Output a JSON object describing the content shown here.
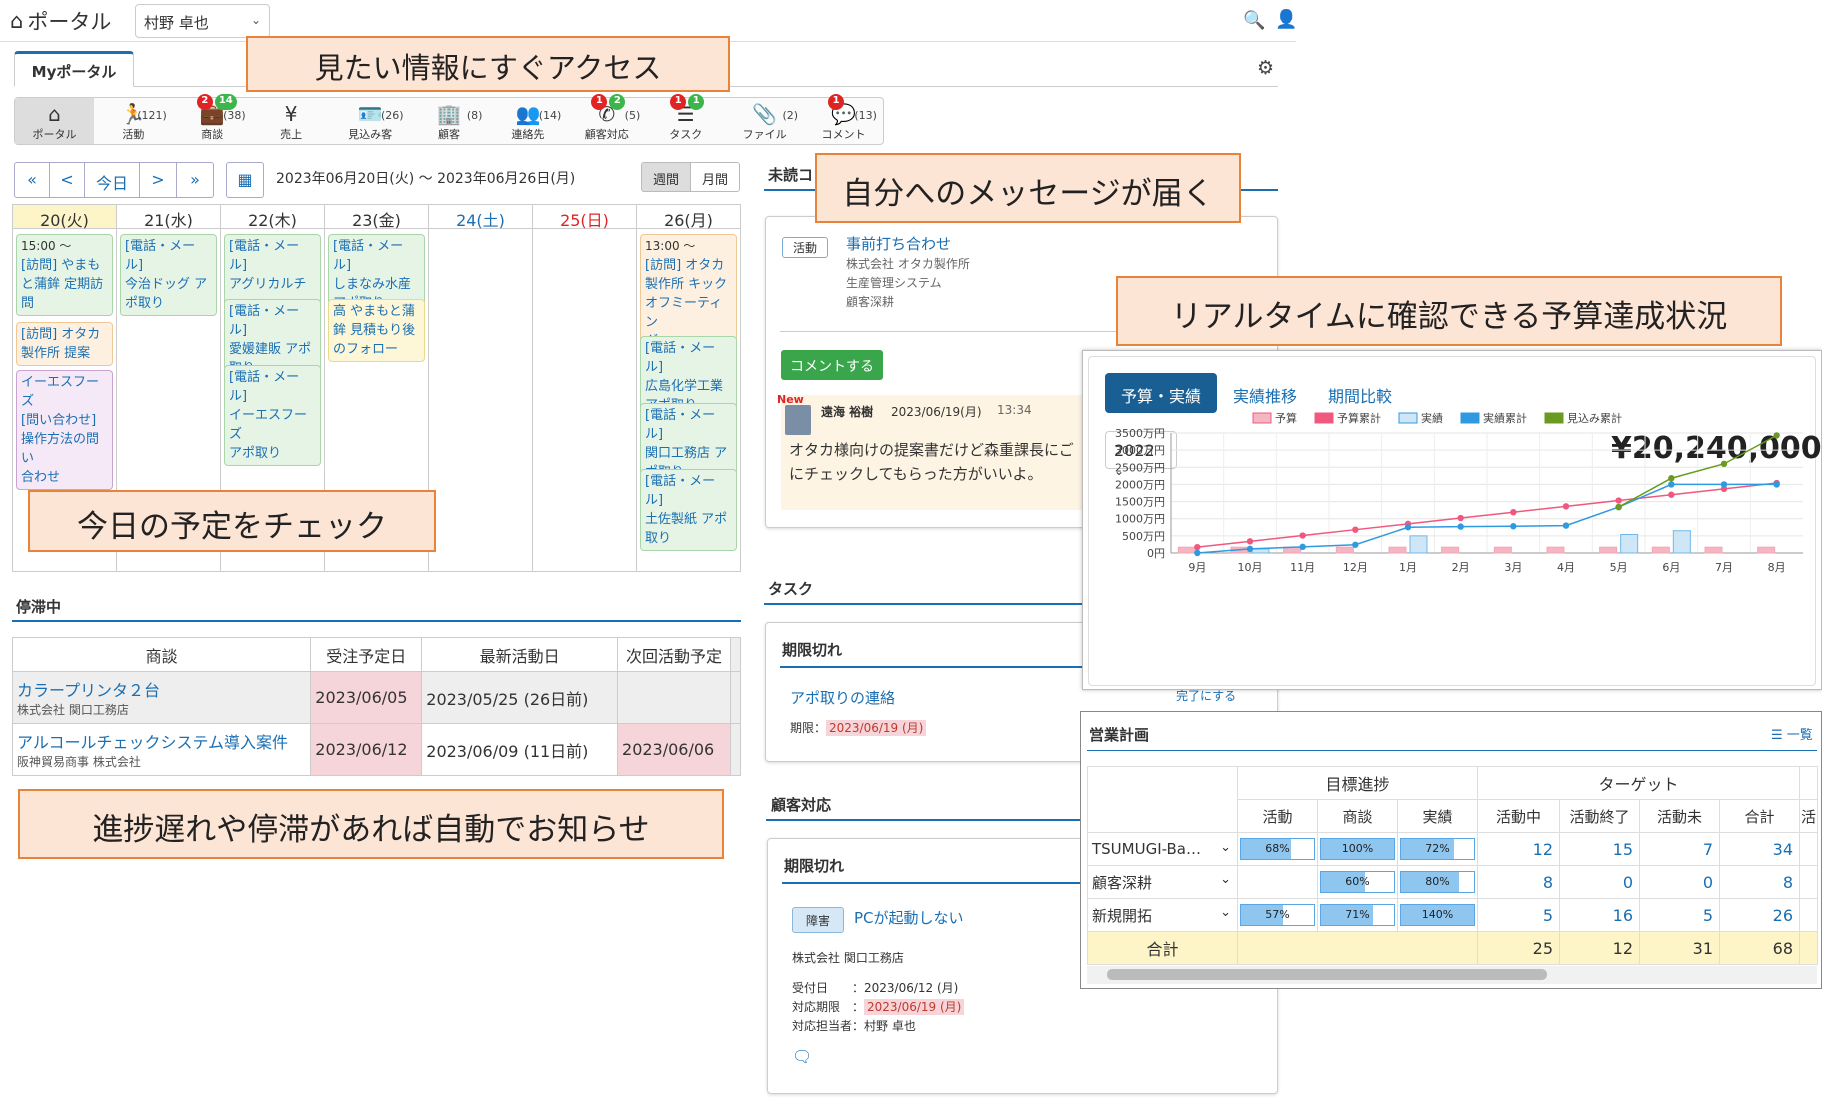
{
  "topbar": {
    "app_title": "ポータル",
    "user": "村野 卓也"
  },
  "tab": {
    "label": "Myポータル"
  },
  "modules": [
    {
      "icon": "home-icon",
      "label": "ポータル",
      "count": "",
      "badges": []
    },
    {
      "icon": "running-icon",
      "label": "活動",
      "count": "(121)",
      "badges": []
    },
    {
      "icon": "briefcase-icon",
      "label": "商談",
      "count": "(38)",
      "badges": [
        {
          "v": "2",
          "c": "red"
        },
        {
          "v": "14",
          "c": "green"
        }
      ]
    },
    {
      "icon": "yen-doc-icon",
      "label": "売上",
      "count": "",
      "badges": []
    },
    {
      "icon": "id-card-icon",
      "label": "見込み客",
      "count": "(26)",
      "badges": []
    },
    {
      "icon": "building-icon",
      "label": "顧客",
      "count": "(8)",
      "badges": []
    },
    {
      "icon": "people-icon",
      "label": "連絡先",
      "count": "(14)",
      "badges": []
    },
    {
      "icon": "phone-icon",
      "label": "顧客対応",
      "count": "(5)",
      "badges": [
        {
          "v": "1",
          "c": "red"
        },
        {
          "v": "2",
          "c": "green"
        }
      ]
    },
    {
      "icon": "tasks-icon",
      "label": "タスク",
      "count": "",
      "badges": [
        {
          "v": "1",
          "c": "red"
        },
        {
          "v": "1",
          "c": "green"
        }
      ]
    },
    {
      "icon": "paperclip-icon",
      "label": "ファイル",
      "count": "(2)",
      "badges": []
    },
    {
      "icon": "comments-icon",
      "label": "コメント",
      "count": "(13)",
      "badges": [
        {
          "v": "1",
          "c": "red"
        }
      ]
    }
  ],
  "calnav": {
    "first": "«",
    "prev": "<",
    "today": "今日",
    "next": ">",
    "last": "»",
    "range": "2023年06月20日(火) ～ 2023年06月26日(月)",
    "week": "週間",
    "month": "月間"
  },
  "calendar": {
    "days": [
      "20(火)",
      "21(水)",
      "22(木)",
      "23(金)",
      "24(土)",
      "25(日)",
      "26(月)"
    ],
    "events": [
      {
        "day": 0,
        "lines": [
          "15:00 ～",
          "[訪問] やまも",
          "と蒲鉾 定期訪",
          "問"
        ],
        "style": "green"
      },
      {
        "day": 0,
        "lines": [
          "[訪問] オタカ",
          "製作所 提案"
        ],
        "style": "orange"
      },
      {
        "day": 0,
        "lines": [
          "イーエスフーズ",
          "[問い合わせ]",
          "操作方法の問い",
          "合わせ"
        ],
        "style": "purple"
      },
      {
        "day": 1,
        "lines": [
          "[電話・メール]",
          "今治ドッグ ア",
          "ポ取り"
        ],
        "style": "green"
      },
      {
        "day": 2,
        "lines": [
          "[電話・メール]",
          "アグリカルチャ",
          "ー アポ取り"
        ],
        "style": "green"
      },
      {
        "day": 2,
        "lines": [
          "[電話・メール]",
          "愛媛建販 アポ",
          "取り"
        ],
        "style": "green"
      },
      {
        "day": 2,
        "lines": [
          "[電話・メール]",
          "イーエスフーズ",
          "アポ取り"
        ],
        "style": "green"
      },
      {
        "day": 3,
        "lines": [
          "[電話・メール]",
          "しまなみ水産",
          "アポ取り"
        ],
        "style": "green"
      },
      {
        "day": 3,
        "lines": [
          "高 やまもと蒲",
          "鉾 見積もり後",
          "のフォロー"
        ],
        "style": "yellow"
      },
      {
        "day": 6,
        "lines": [
          "13:00 ～",
          "[訪問] オタカ",
          "製作所 キック",
          "オフミーティン",
          "グ"
        ],
        "style": "orange"
      },
      {
        "day": 6,
        "lines": [
          "[電話・メール]",
          "広島化学工業",
          "アポ取り"
        ],
        "style": "green"
      },
      {
        "day": 6,
        "lines": [
          "[電話・メール]",
          "関口工務店 ア",
          "ポ取り"
        ],
        "style": "green"
      },
      {
        "day": 6,
        "lines": [
          "[電話・メール]",
          "土佐製紙 アポ",
          "取り"
        ],
        "style": "green"
      }
    ]
  },
  "stagnation": {
    "title": "停滞中",
    "headers": [
      "商談",
      "受注予定日",
      "最新活動日",
      "次回活動予定"
    ],
    "rows": [
      {
        "name": "カラープリンタ２台",
        "company": "株式会社 関口工務店",
        "order": "2023/06/05",
        "latest": "2023/05/25 (26日前)",
        "next": ""
      },
      {
        "name": "アルコールチェックシステム導入案件",
        "company": "阪神貿易商事 株式会社",
        "order": "2023/06/12",
        "latest": "2023/06/09 (11日前)",
        "next": "2023/06/06"
      }
    ]
  },
  "unread": {
    "title": "未読コ",
    "tag": "活動",
    "subject": "事前打ち合わせ",
    "company": "株式会社 オタカ製作所",
    "system": "生産管理システム",
    "category": "顧客深耕",
    "comment_button": "コメントする",
    "new_label": "New",
    "author": "遠海 裕樹",
    "date": "2023/06/19(月)",
    "time": "13:34",
    "body1": "オタカ様向けの提案書だけど森重課長にご",
    "body2": "にチェックしてもらった方がいいよ。"
  },
  "tasks": {
    "title": "タスク",
    "overdue": "期限切れ",
    "item": "アポ取りの連絡",
    "deadline_label": "期限：",
    "deadline": "2023/06/19 (月)",
    "done": "完了にする"
  },
  "customer": {
    "title": "顧客対応",
    "overdue": "期限切れ",
    "tag": "障害",
    "item": "PCが起動しない",
    "company": "株式会社 関口工務店",
    "received_label": "受付日　　：",
    "received": "2023/06/12 (月)",
    "due_label": "対応期限　：",
    "due": "2023/06/19 (月)",
    "owner_label": "対応担当者：",
    "owner": "村野 卓也"
  },
  "budget": {
    "tabs": [
      "予算・実績",
      "実績推移",
      "期間比較"
    ],
    "year": "2022",
    "amount": "¥20,240,000"
  },
  "chart_data": {
    "type": "bar",
    "categories": [
      "9月",
      "10月",
      "11月",
      "12月",
      "1月",
      "2月",
      "3月",
      "4月",
      "5月",
      "6月",
      "7月",
      "8月"
    ],
    "ylabel": "",
    "ylim": [
      0,
      3500
    ],
    "yticks": [
      "0円",
      "500万円",
      "1000万円",
      "1500万円",
      "2000万円",
      "2500万円",
      "3000万円",
      "3500万円"
    ],
    "legend_position": "top",
    "series": [
      {
        "name": "予算",
        "kind": "bar",
        "color": "#f4b6c2",
        "values": [
          170,
          170,
          170,
          170,
          170,
          170,
          170,
          170,
          170,
          170,
          170,
          170
        ]
      },
      {
        "name": "予算累計",
        "kind": "line",
        "color": "#f0587e",
        "values": [
          170,
          340,
          510,
          680,
          850,
          1020,
          1190,
          1360,
          1530,
          1700,
          1870,
          2040
        ]
      },
      {
        "name": "実績",
        "kind": "bar",
        "color": "#cfe6f7",
        "values": [
          0,
          120,
          0,
          0,
          500,
          0,
          0,
          0,
          540,
          650,
          0,
          0
        ]
      },
      {
        "name": "実績累計",
        "kind": "line",
        "color": "#2f9ae0",
        "values": [
          0,
          120,
          180,
          240,
          750,
          770,
          780,
          800,
          1340,
          2000,
          2000,
          2000
        ]
      },
      {
        "name": "見込み累計",
        "kind": "line",
        "color": "#6a9a1f",
        "values": [
          null,
          null,
          null,
          null,
          null,
          null,
          null,
          null,
          1340,
          2180,
          2600,
          3430
        ]
      }
    ]
  },
  "plan": {
    "title": "営業計画",
    "list_link": "一覧",
    "group1": "目標進捗",
    "group2": "ターゲット",
    "sub": [
      "活動",
      "商談",
      "実績",
      "活動中",
      "活動終了",
      "活動未",
      "合計",
      "活"
    ],
    "rows": [
      {
        "name": "TSUMUGI-Ba…",
        "bars": [
          {
            "p": 68,
            "t": "68%"
          },
          {
            "p": 100,
            "t": "100%"
          },
          {
            "p": 72,
            "t": "72%"
          }
        ],
        "vals": [
          "12",
          "15",
          "7",
          "34"
        ]
      },
      {
        "name": "顧客深耕",
        "bars": [
          null,
          {
            "p": 60,
            "t": "60%"
          },
          {
            "p": 80,
            "t": "80%"
          }
        ],
        "vals": [
          "8",
          "0",
          "0",
          "8"
        ]
      },
      {
        "name": "新規開拓",
        "bars": [
          {
            "p": 57,
            "t": "57%"
          },
          {
            "p": 71,
            "t": "71%"
          },
          {
            "p": 140,
            "t": "140%"
          }
        ],
        "vals": [
          "5",
          "16",
          "5",
          "26"
        ]
      }
    ],
    "total_label": "合計",
    "total_vals": [
      "25",
      "12",
      "31",
      "68"
    ]
  },
  "callouts": {
    "access": "見たい情報にすぐアクセス",
    "message": "自分へのメッセージが届く",
    "budget": "リアルタイムに確認できる予算達成状況",
    "today": "今日の予定をチェック",
    "delay": "進捗遅れや停滞があれば自動でお知らせ"
  }
}
